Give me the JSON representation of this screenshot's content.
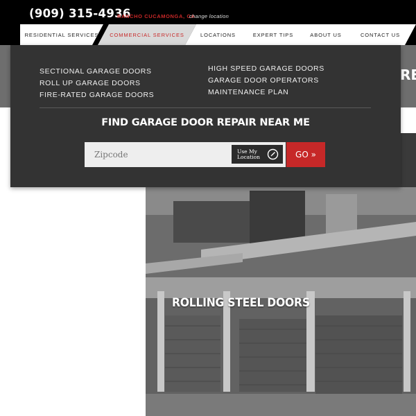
{
  "header": {
    "phone": "(909) 315-4936",
    "city": "RANCHO CUCAMONGA, CA",
    "change_location": "change location"
  },
  "nav": {
    "tabs": [
      {
        "label": "RESIDENTIAL SERVICES",
        "active": false
      },
      {
        "label": "COMMERCIAL SERVICES",
        "active": true
      },
      {
        "label": "LOCATIONS",
        "active": false
      },
      {
        "label": "EXPERT TIPS",
        "active": false
      },
      {
        "label": "ABOUT US",
        "active": false
      },
      {
        "label": "CONTACT US",
        "active": false
      }
    ]
  },
  "dropdown": {
    "left_items": [
      "SECTIONAL GARAGE DOORS",
      "ROLL UP GARAGE DOORS",
      "FIRE-RATED GARAGE DOORS"
    ],
    "right_items": [
      "HIGH SPEED GARAGE DOORS",
      "GARAGE DOOR OPERATORS",
      "MAINTENANCE PLAN"
    ],
    "find_heading": "FIND GARAGE DOOR REPAIR NEAR ME",
    "zip_placeholder": "Zipcode",
    "use_location": "Use My Location",
    "go_label": "GO »"
  },
  "page": {
    "hero_partial_text": "REP",
    "photo_title": "ROLLING STEEL DOORS"
  },
  "colors": {
    "accent": "#c62828",
    "topbar": "#000000",
    "dropdown_bg": "#333333"
  }
}
